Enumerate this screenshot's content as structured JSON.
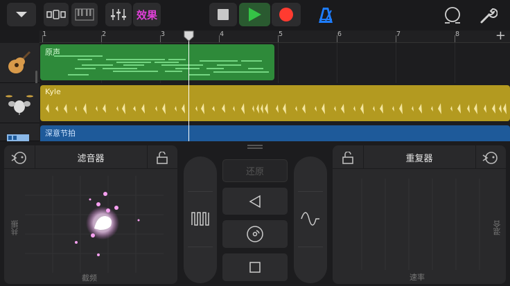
{
  "toolbar": {
    "effects_label": "效果",
    "icons": [
      "dropdown-icon",
      "tracks-view-icon",
      "piano-keyboard-icon",
      "mixer-sliders-icon",
      "stop-icon",
      "play-icon",
      "record-icon",
      "metronome-icon",
      "loop-icon",
      "settings-wrench-icon"
    ]
  },
  "ruler": {
    "bars": [
      "1",
      "2",
      "3",
      "4",
      "5",
      "6",
      "7",
      "8"
    ],
    "add_label": "+"
  },
  "tracks": [
    {
      "name": "原声",
      "instrument": "acoustic-guitar-icon",
      "color": "#2f8a3a"
    },
    {
      "name": "Kyle",
      "instrument": "drum-kit-icon",
      "color": "#b39a20"
    },
    {
      "name": "深意节拍",
      "instrument": "beat-sequencer-icon",
      "color": "#1e5a9a"
    }
  ],
  "fx": {
    "filter": {
      "title": "滤音器",
      "x_label": "截频",
      "y_label": "共振"
    },
    "center": {
      "restore_label": "还原"
    },
    "repeat": {
      "title": "重复器",
      "x_label": "速率",
      "y_label": "混合"
    }
  },
  "colors": {
    "accent_play": "#35c346",
    "record": "#ff3b30",
    "effects": "#e040d8",
    "metronome": "#1e7dff"
  }
}
